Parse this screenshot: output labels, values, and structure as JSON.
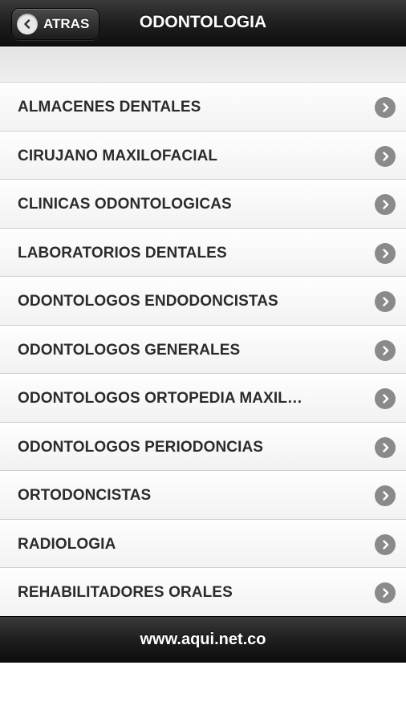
{
  "header": {
    "back_label": "ATRAS",
    "title": "ODONTOLOGIA"
  },
  "list": {
    "items": [
      {
        "label": "ALMACENES DENTALES"
      },
      {
        "label": "CIRUJANO MAXILOFACIAL"
      },
      {
        "label": "CLINICAS ODONTOLOGICAS"
      },
      {
        "label": "LABORATORIOS DENTALES"
      },
      {
        "label": "ODONTOLOGOS ENDODONCISTAS"
      },
      {
        "label": "ODONTOLOGOS GENERALES"
      },
      {
        "label": "ODONTOLOGOS ORTOPEDIA MAXIL…"
      },
      {
        "label": "ODONTOLOGOS PERIODONCIAS"
      },
      {
        "label": "ORTODONCISTAS"
      },
      {
        "label": "RADIOLOGIA"
      },
      {
        "label": "REHABILITADORES ORALES"
      }
    ]
  },
  "footer": {
    "text": "www.aqui.net.co"
  }
}
